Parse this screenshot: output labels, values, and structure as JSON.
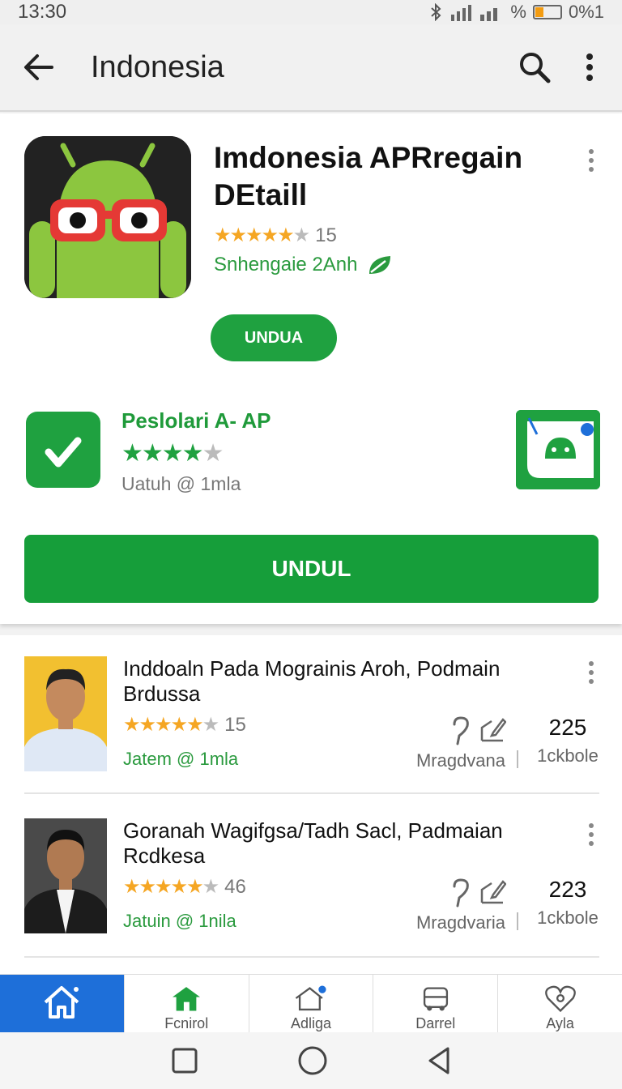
{
  "status_bar": {
    "time": "13:30",
    "right_text": "✱ ❙❙ ❙❙%",
    "battery": "0%1"
  },
  "app_bar": {
    "title": "Indonesia",
    "icons": [
      "back-arrow-icon",
      "search-icon",
      "more-vert-icon"
    ]
  },
  "main_app": {
    "title": "Imdonesia APRregain DEtaill",
    "rating_count": "15",
    "rating_stars": 4.5,
    "developer": "Snhengaie 2Anh",
    "install_label": "UNDUA"
  },
  "secondary_app": {
    "title": "Peslolari A- AP",
    "rating_stars": 3.5,
    "meta": "Uatuh @ 1mla",
    "big_button_label": "UNDUL"
  },
  "list_items": [
    {
      "title": "Inddoaln Pada Mograinis Aroh, Podmain Brdussa",
      "rating_count": "15",
      "meta": "Jatem @ 1mla",
      "stat_label_1": "Mragdvana",
      "stat_num": "225",
      "stat_label_2": "1ckbole"
    },
    {
      "title": "Goranah Wagifgsa/Tadh Sacl, Padmaian Rcdkesa",
      "rating_count": "46",
      "meta": "Jatuin @ 1nila",
      "stat_label_1": "Mragdvaria",
      "stat_num": "223",
      "stat_label_2": "1ckbole"
    }
  ],
  "bottom_nav": {
    "items": [
      {
        "label": "",
        "icon": "home-icon"
      },
      {
        "label": "Fcnirol",
        "icon": "store-icon"
      },
      {
        "label": "Adliga",
        "icon": "house-gear-icon"
      },
      {
        "label": "Darrel",
        "icon": "bus-icon"
      },
      {
        "label": "Ayla",
        "icon": "heart-icon"
      }
    ]
  },
  "colors": {
    "accent_green": "#1fa140",
    "nav_blue": "#1e6fd9",
    "star": "#f5a623"
  }
}
